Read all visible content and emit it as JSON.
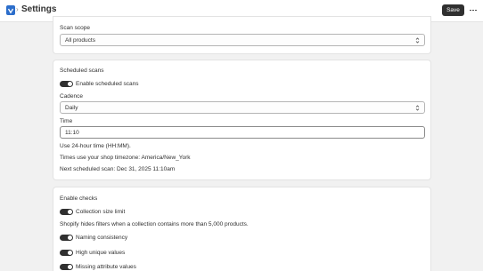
{
  "header": {
    "title": "Settings",
    "save_label": "Save"
  },
  "scan_scope": {
    "label": "Scan scope",
    "value": "All products"
  },
  "scheduled": {
    "heading": "Scheduled scans",
    "enable_label": "Enable scheduled scans",
    "enable_on": true,
    "cadence_label": "Cadence",
    "cadence_value": "Daily",
    "time_label": "Time",
    "time_value": "11:10",
    "help_format": "Use 24-hour time (HH:MM).",
    "help_timezone": "Times use your shop timezone: America/New_York",
    "next_scan": "Next scheduled scan: Dec 31, 2025 11:10am"
  },
  "checks": {
    "heading": "Enable checks",
    "items": [
      {
        "label": "Collection size limit",
        "on": true
      },
      {
        "label": "Naming consistency",
        "on": true
      },
      {
        "label": "High unique values",
        "on": true
      },
      {
        "label": "Missing attribute values",
        "on": true
      }
    ],
    "collection_help": "Shopify hides filters when a collection contains more than 5,000 products."
  },
  "colors": {
    "accent": "#303030",
    "app_icon": "#2c6ecb",
    "background": "#f1f1f1"
  },
  "icons": {
    "app": "app-logo-icon",
    "more": "more-horizontal-icon",
    "select": "select-chevron-icon"
  }
}
